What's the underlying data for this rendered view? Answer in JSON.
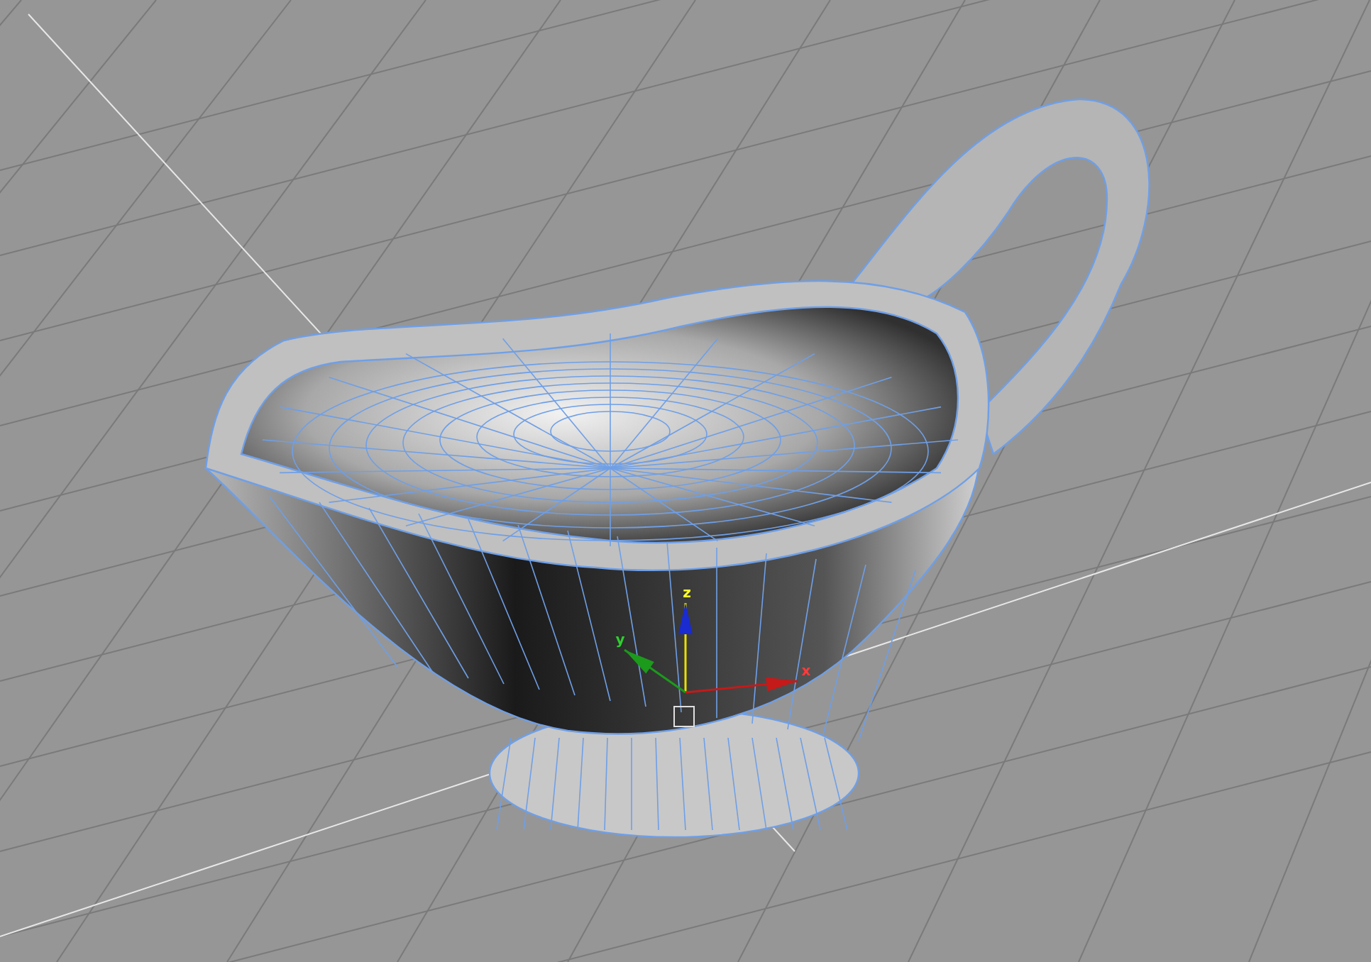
{
  "viewport": {
    "gizmo": {
      "axes": [
        {
          "kind": "z",
          "label": "z",
          "color": "#1a2bd0"
        },
        {
          "kind": "y",
          "label": "y",
          "color": "#1c9a1c"
        },
        {
          "kind": "x",
          "label": "x",
          "color": "#c41a1a"
        }
      ]
    }
  }
}
